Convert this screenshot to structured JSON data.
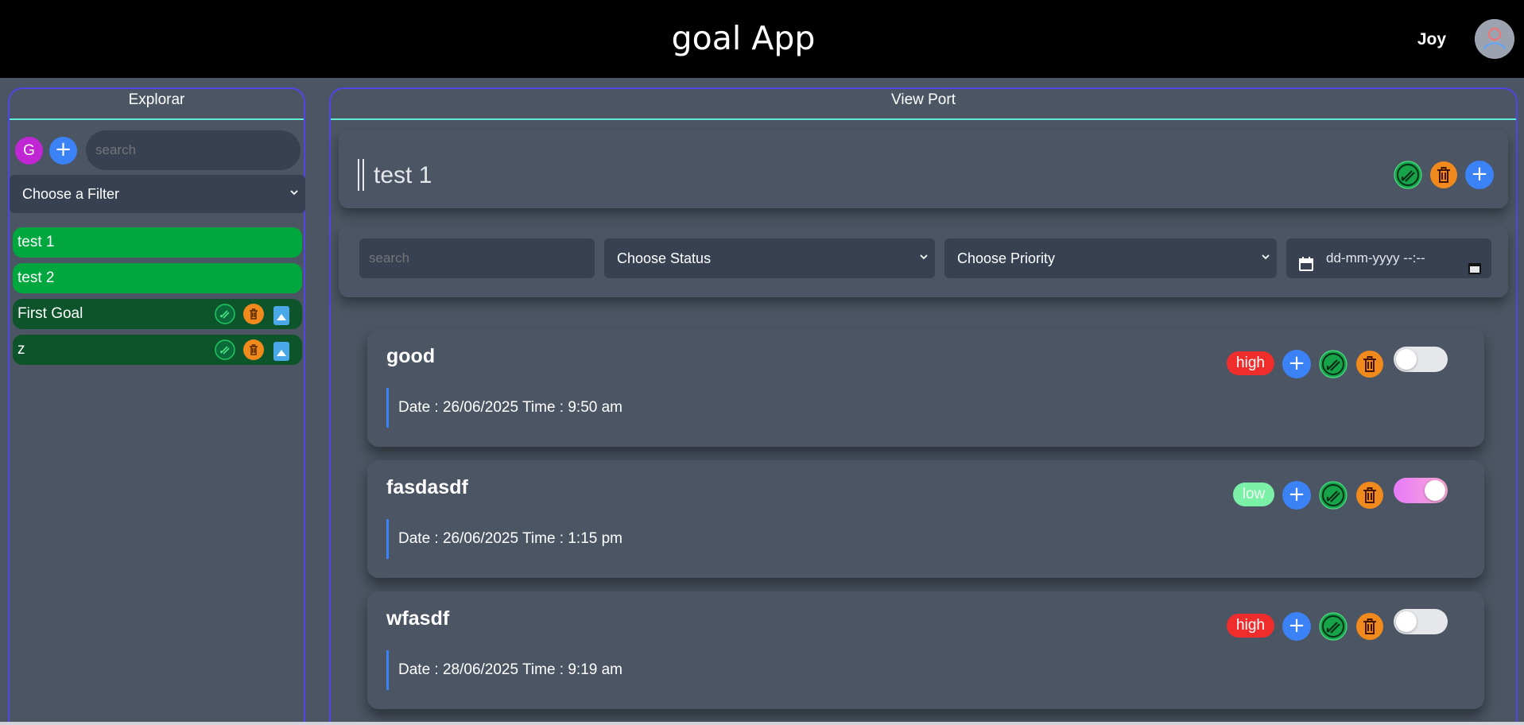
{
  "header": {
    "app_title": "goal App",
    "user_name": "Joy"
  },
  "explorer": {
    "title": "Explorar",
    "avatar_letter": "G",
    "add_label": "+",
    "search_placeholder": "search",
    "filter_label": "Choose a Filter",
    "goals": [
      {
        "label": "test 1",
        "style": "light"
      },
      {
        "label": "test 2",
        "style": "light"
      },
      {
        "label": "First Goal",
        "style": "dark"
      },
      {
        "label": "z",
        "style": "dark"
      }
    ]
  },
  "viewport": {
    "title": "View Port",
    "goal_title": "test 1",
    "add_label": "+",
    "search_placeholder": "search",
    "status_label": "Choose Status",
    "priority_label": "Choose Priority",
    "date_placeholder": "dd-mm-yyyy --:--",
    "tasks": [
      {
        "title": "good",
        "date": "Date : 26/06/2025 Time : 9:50 am",
        "priority": "high",
        "done": false
      },
      {
        "title": "fasdasdf",
        "date": "Date : 26/06/2025 Time : 1:15 pm",
        "priority": "low",
        "done": true
      },
      {
        "title": "wfasdf",
        "date": "Date : 28/06/2025 Time : 9:19 am",
        "priority": "high",
        "done": false
      }
    ]
  },
  "colors": {
    "header_bg": "#000000",
    "panel_border": "#4f46e5",
    "title_underline": "#5eead4",
    "goal_active": "#00a63e",
    "goal_inactive": "#0d542b",
    "accent_blue": "#3b82f6",
    "priority_high": "#ef2d2d",
    "priority_low": "#7bf1a8",
    "edit_green": "#0a6b3a",
    "trash_orange": "#f08a1c"
  },
  "icons": [
    "user-avatar-icon",
    "plus-icon",
    "edit-icon",
    "trash-icon",
    "arrow-up-icon",
    "calendar-icon",
    "chevron-down-icon",
    "toggle-switch"
  ]
}
